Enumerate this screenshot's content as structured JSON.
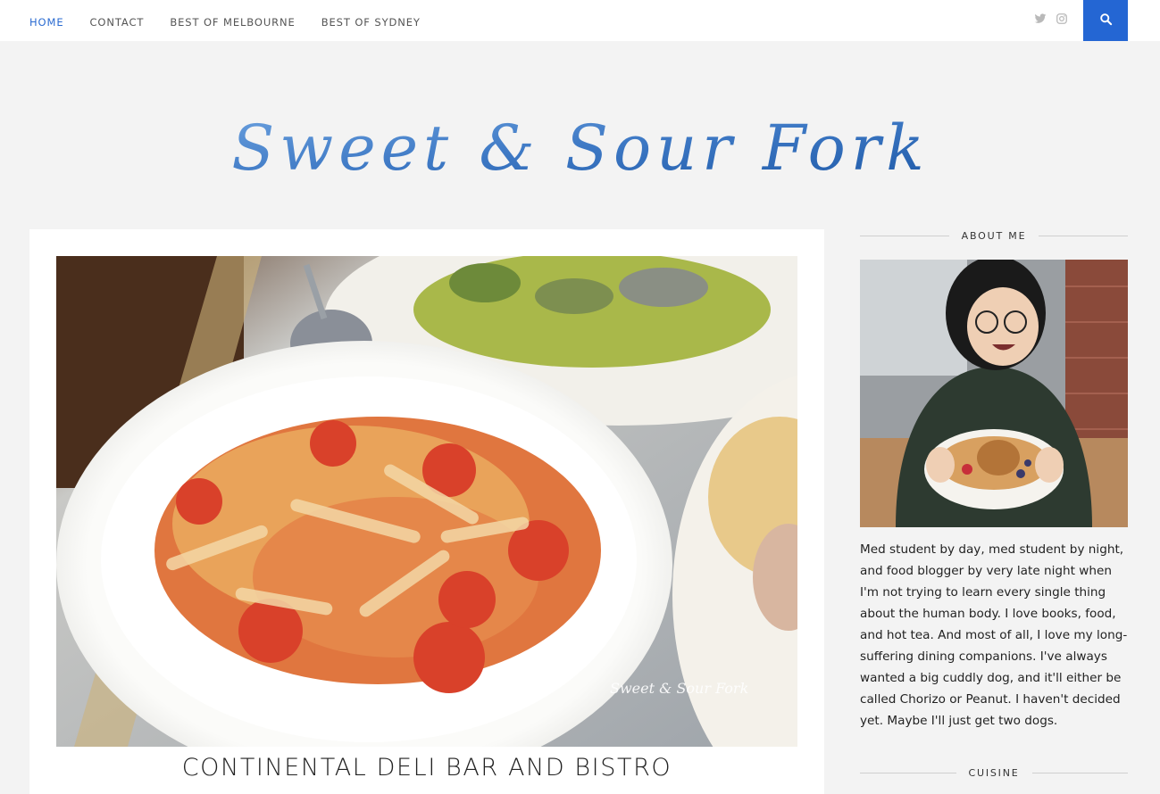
{
  "nav": {
    "items": [
      {
        "label": "HOME",
        "active": true
      },
      {
        "label": "CONTACT",
        "active": false
      },
      {
        "label": "BEST OF MELBOURNE",
        "active": false
      },
      {
        "label": "BEST OF SYDNEY",
        "active": false
      }
    ]
  },
  "social": {
    "icons": [
      "twitter-icon",
      "instagram-icon"
    ]
  },
  "search": {
    "icon": "search-icon"
  },
  "brand": {
    "logo_text": "Sweet & Sour Fork",
    "accent": "#2466d3"
  },
  "post": {
    "title": "CONTINENTAL DELI BAR AND BISTRO",
    "image_watermark": "Sweet & Sour Fork"
  },
  "sidebar": {
    "about": {
      "heading": "ABOUT ME",
      "text": "Med student by day, med student by night, and food blogger by very late night when I'm not trying to learn every single thing about the human body. I love books, food, and hot tea. And most of all, I love my long-suffering dining companions. I've always wanted a big cuddly dog, and it'll either be called Chorizo or Peanut. I haven't decided yet. Maybe I'll just get two dogs."
    },
    "cuisine": {
      "heading": "CUISINE"
    }
  }
}
